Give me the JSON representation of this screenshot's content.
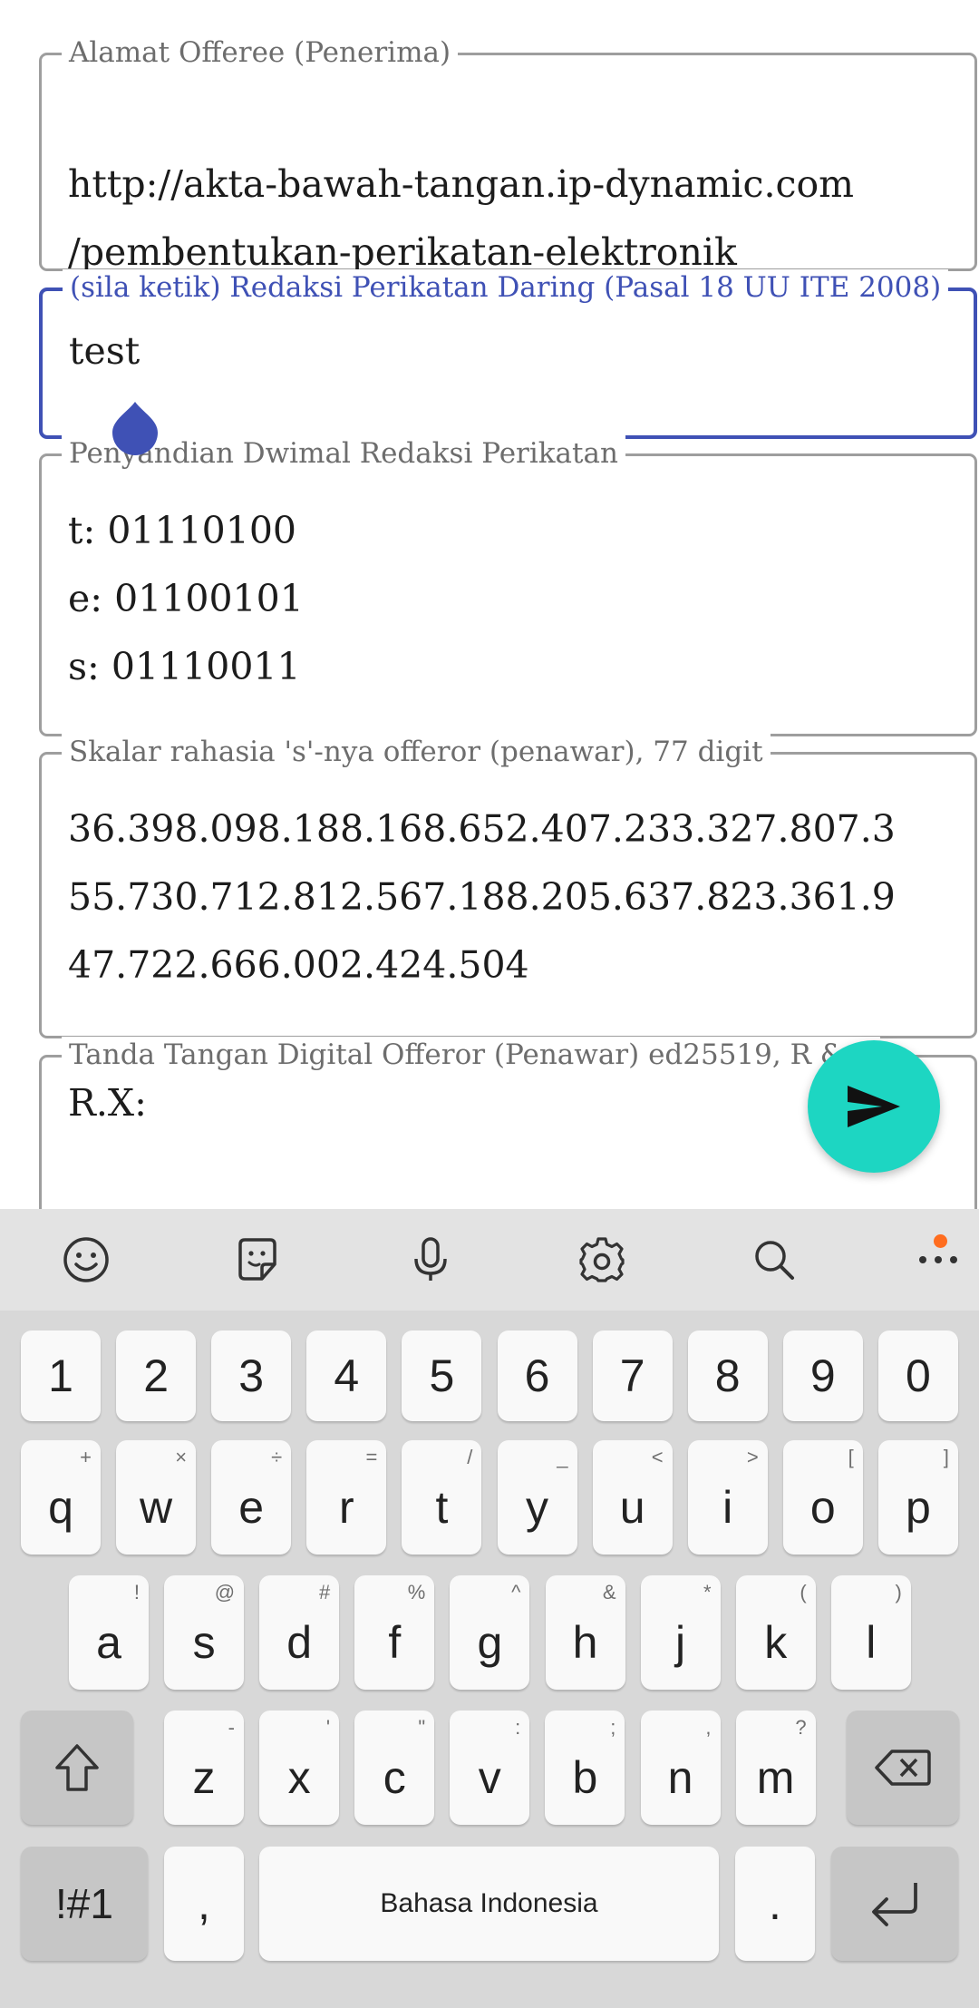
{
  "fields": [
    {
      "label": "Alamat Offeree (Penerima)",
      "value": "http://akta-bawah-tangan.ip-dynamic.com\n/pembentukan-perikatan-elektronik"
    },
    {
      "label": "(sila ketik) Redaksi Perikatan Daring (Pasal 18 UU ITE 2008)",
      "value": "test"
    },
    {
      "label": "Penyandian Dwimal Redaksi Perikatan",
      "value": "t: 01110100\ne: 01100101\ns: 01110011"
    },
    {
      "label": "Skalar rahasia 's'-nya offeror (penawar), 77 digit",
      "value": "36.398.098.188.168.652.407.233.327.807.3\n55.730.712.812.567.188.205.637.823.361.9\n47.722.666.002.424.504"
    },
    {
      "label": "Tanda Tangan Digital Offeror (Penawar) ed25519, R & S",
      "value": "R.X:"
    }
  ],
  "colors": {
    "accent": "#3f51b5",
    "fab": "#1dd6c2",
    "badge": "#ff6d1f"
  },
  "fab_icon": "send-icon",
  "keyboard": {
    "toolbar_icons": [
      "emoji-icon",
      "sticker-icon",
      "microphone-icon",
      "settings-icon",
      "search-icon",
      "more-icon"
    ],
    "row_numbers": [
      "1",
      "2",
      "3",
      "4",
      "5",
      "6",
      "7",
      "8",
      "9",
      "0"
    ],
    "row_q": [
      {
        "key": "q",
        "hint": "+"
      },
      {
        "key": "w",
        "hint": "×"
      },
      {
        "key": "e",
        "hint": "÷"
      },
      {
        "key": "r",
        "hint": "="
      },
      {
        "key": "t",
        "hint": "/"
      },
      {
        "key": "y",
        "hint": "_"
      },
      {
        "key": "u",
        "hint": "<"
      },
      {
        "key": "i",
        "hint": ">"
      },
      {
        "key": "o",
        "hint": "["
      },
      {
        "key": "p",
        "hint": "]"
      }
    ],
    "row_a": [
      {
        "key": "a",
        "hint": "!"
      },
      {
        "key": "s",
        "hint": "@"
      },
      {
        "key": "d",
        "hint": "#"
      },
      {
        "key": "f",
        "hint": "%"
      },
      {
        "key": "g",
        "hint": "^"
      },
      {
        "key": "h",
        "hint": "&"
      },
      {
        "key": "j",
        "hint": "*"
      },
      {
        "key": "k",
        "hint": "("
      },
      {
        "key": "l",
        "hint": ")"
      }
    ],
    "row_z": [
      {
        "key": "z",
        "hint": "-"
      },
      {
        "key": "x",
        "hint": "'"
      },
      {
        "key": "c",
        "hint": "\""
      },
      {
        "key": "v",
        "hint": ":"
      },
      {
        "key": "b",
        "hint": ";"
      },
      {
        "key": "n",
        "hint": ","
      },
      {
        "key": "m",
        "hint": "?"
      }
    ],
    "symbols_label": "!#1",
    "comma_label": ",",
    "space_label": "Bahasa Indonesia",
    "period_label": "."
  }
}
